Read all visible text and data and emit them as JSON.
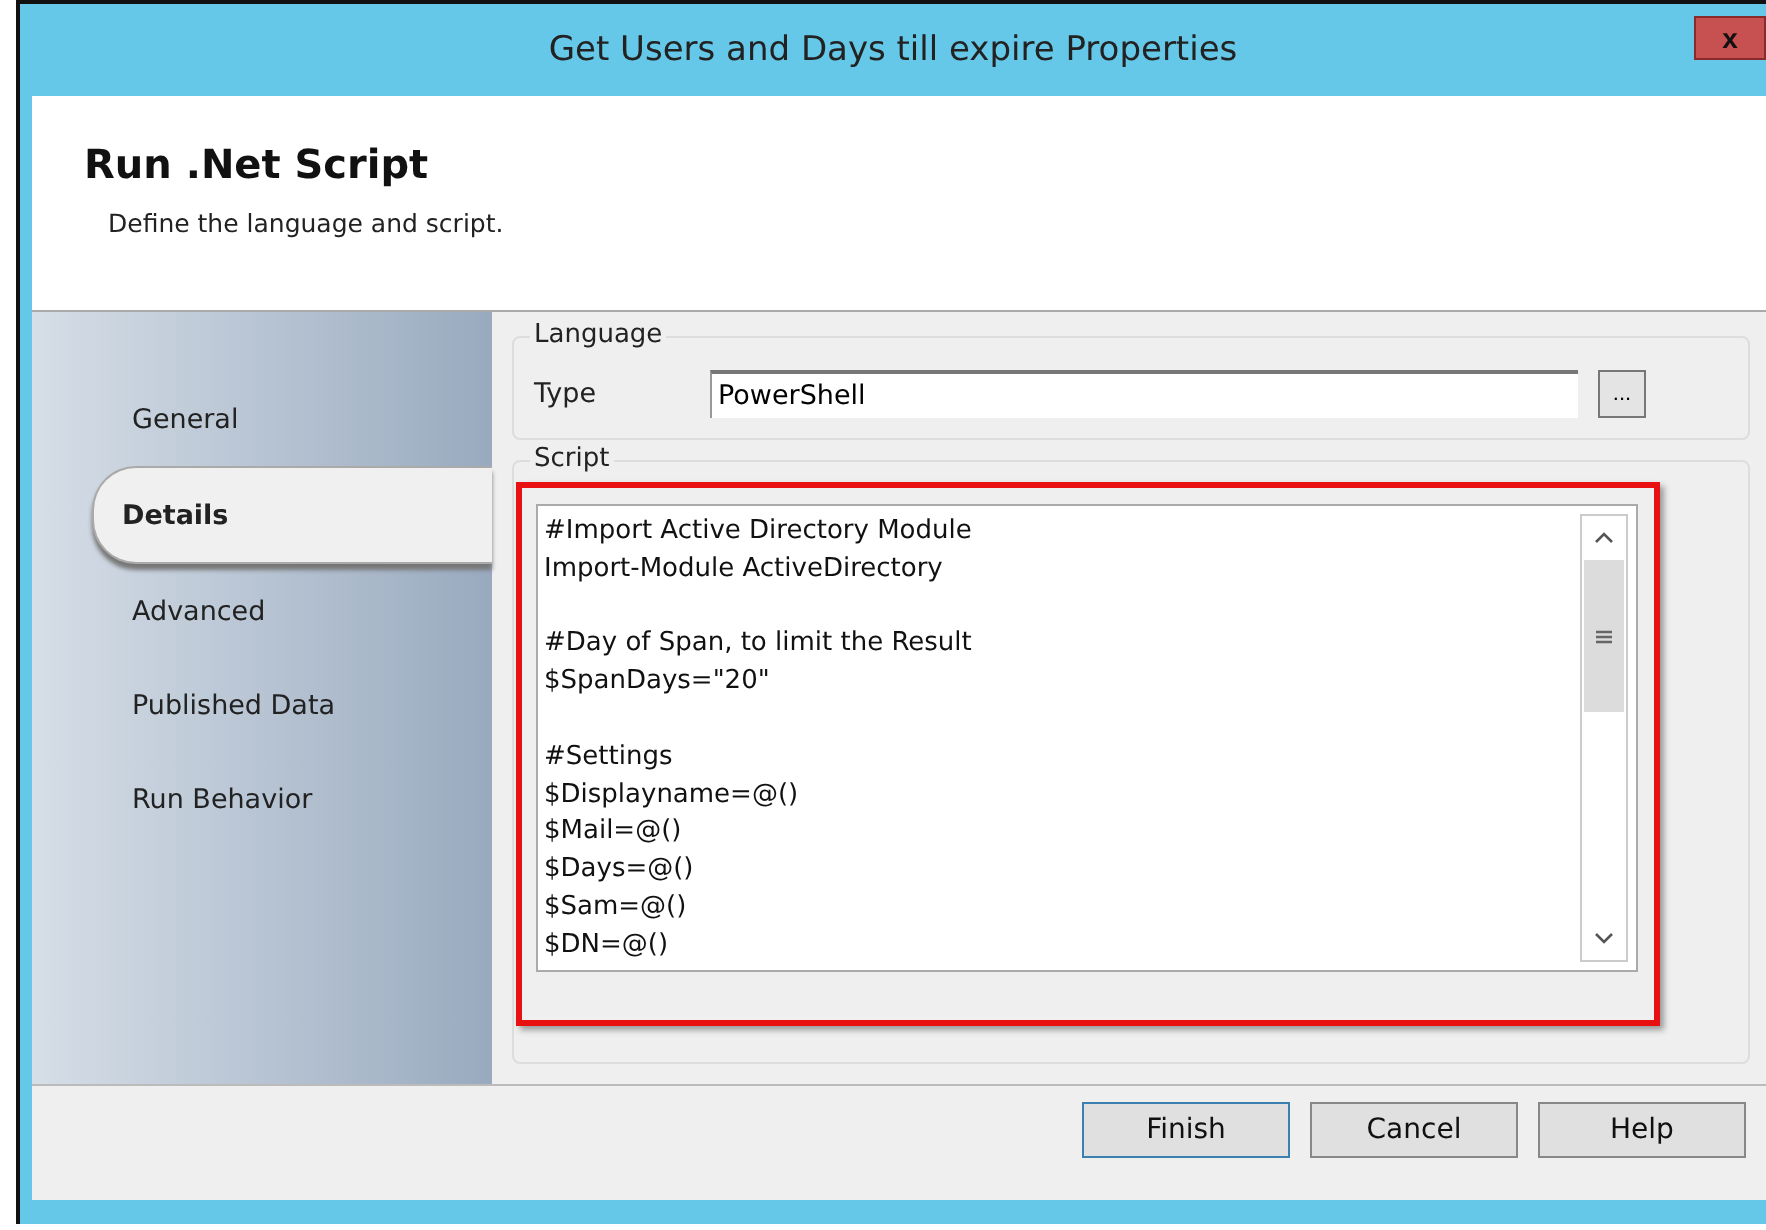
{
  "window": {
    "title": "Get Users and Days till expire Properties",
    "close_label": "x"
  },
  "header": {
    "title": "Run .Net Script",
    "subtitle": "Define the language and script."
  },
  "sidebar": {
    "items": [
      {
        "label": "General",
        "selected": false
      },
      {
        "label": "Details",
        "selected": true
      },
      {
        "label": "Advanced",
        "selected": false
      },
      {
        "label": "Published Data",
        "selected": false
      },
      {
        "label": "Run Behavior",
        "selected": false
      }
    ]
  },
  "language": {
    "legend": "Language",
    "type_label": "Type",
    "type_value": "PowerShell",
    "browse_label": "..."
  },
  "script": {
    "legend": "Script",
    "blocks": [
      [
        "#Import Active Directory Module",
        "Import-Module ActiveDirectory"
      ],
      [
        "#Day of Span, to limit the Result",
        "$SpanDays=\"20\""
      ],
      [
        "#Settings",
        "$Displayname=@()",
        "$Mail=@()",
        "$Days=@()",
        "$Sam=@()",
        "$DN=@()"
      ]
    ]
  },
  "buttons": [
    {
      "label": "Finish",
      "default": true
    },
    {
      "label": "Cancel",
      "default": false
    },
    {
      "label": "Help",
      "default": false
    }
  ]
}
